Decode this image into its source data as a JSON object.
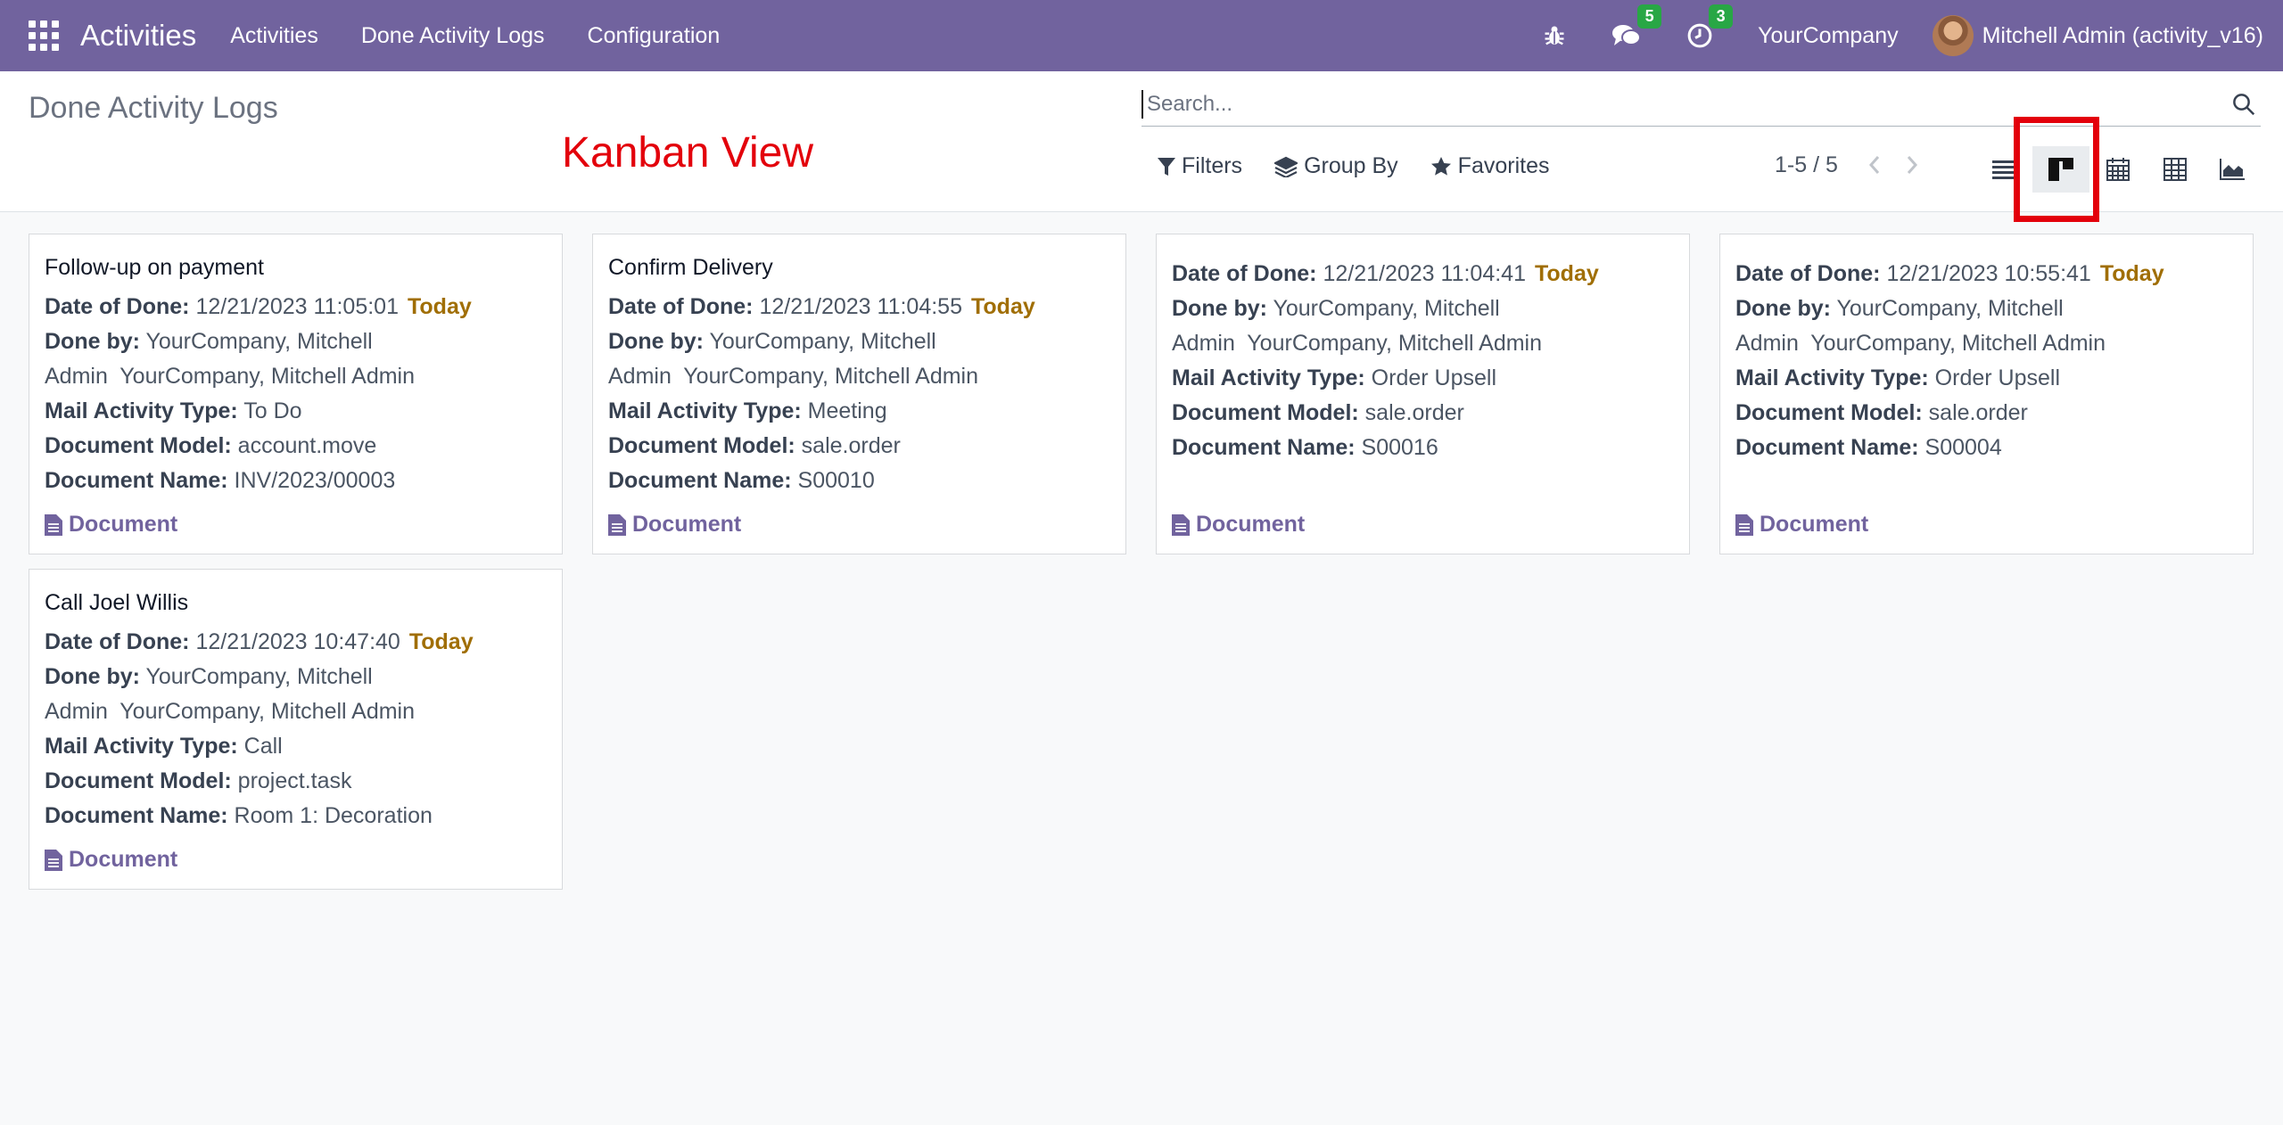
{
  "navbar": {
    "brand": "Activities",
    "menus": [
      "Activities",
      "Done Activity Logs",
      "Configuration"
    ],
    "messages_count": "5",
    "activities_count": "3",
    "company": "YourCompany",
    "user": "Mitchell Admin (activity_v16)",
    "bg_color": "#71639e"
  },
  "control_panel": {
    "title": "Done Activity Logs",
    "annotation": "Kanban View",
    "search_placeholder": "Search...",
    "filters_label": "Filters",
    "groupby_label": "Group By",
    "favorites_label": "Favorites",
    "pager": "1-5 / 5",
    "views": [
      "list-view-icon",
      "kanban-view-icon",
      "calendar-view-icon",
      "pivot-view-icon",
      "graph-view-icon"
    ],
    "active_view": "kanban"
  },
  "labels": {
    "date_of_done": "Date of Done:",
    "done_by": "Done by:",
    "mail_activity_type": "Mail Activity Type:",
    "document_model": "Document Model:",
    "document_name": "Document Name:",
    "today": "Today",
    "document_link": "Document"
  },
  "cards": [
    {
      "title": "Follow-up on payment",
      "date": "12/21/2023 11:05:01",
      "done_by_line1": "YourCompany, Mitchell",
      "done_by_line2": "Admin  YourCompany, Mitchell Admin",
      "type": "To Do",
      "model": "account.move",
      "name": "INV/2023/00003"
    },
    {
      "title": "Confirm Delivery",
      "date": "12/21/2023 11:04:55",
      "done_by_line1": "YourCompany, Mitchell",
      "done_by_line2": "Admin  YourCompany, Mitchell Admin",
      "type": "Meeting",
      "model": "sale.order",
      "name": "S00010"
    },
    {
      "title": "",
      "date": "12/21/2023 11:04:41",
      "done_by_line1": "YourCompany, Mitchell",
      "done_by_line2": "Admin  YourCompany, Mitchell Admin",
      "type": "Order Upsell",
      "model": "sale.order",
      "name": "S00016"
    },
    {
      "title": "",
      "date": "12/21/2023 10:55:41",
      "done_by_line1": "YourCompany, Mitchell",
      "done_by_line2": "Admin  YourCompany, Mitchell Admin",
      "type": "Order Upsell",
      "model": "sale.order",
      "name": "S00004"
    },
    {
      "title": "Call Joel Willis",
      "date": "12/21/2023 10:47:40",
      "done_by_line1": "YourCompany, Mitchell",
      "done_by_line2": "Admin  YourCompany, Mitchell Admin",
      "type": "Call",
      "model": "project.task",
      "name": "Room 1: Decoration"
    }
  ]
}
